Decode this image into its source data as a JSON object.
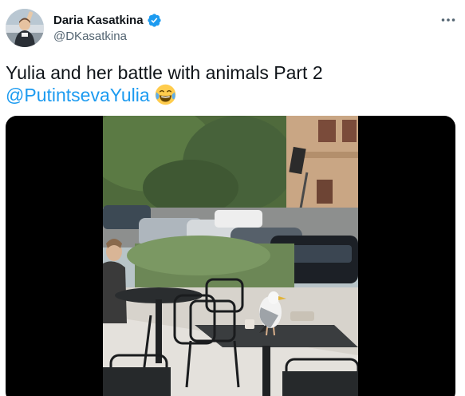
{
  "tweet": {
    "author": {
      "name": "Daria Kasatkina",
      "handle": "@DKasatkina",
      "verified": true,
      "avatar_icon": "profile-photo"
    },
    "text_line1": "Yulia and her battle with animals Part 2",
    "mention": "@PutintsevaYulia",
    "emoji_icon": "face-with-tears-of-joy",
    "more_icon": "more-horizontal-icon",
    "media": {
      "type": "video"
    }
  },
  "colors": {
    "text": "#0f1419",
    "secondary": "#536471",
    "accent": "#1d9bf0",
    "media_background": "#000000"
  }
}
